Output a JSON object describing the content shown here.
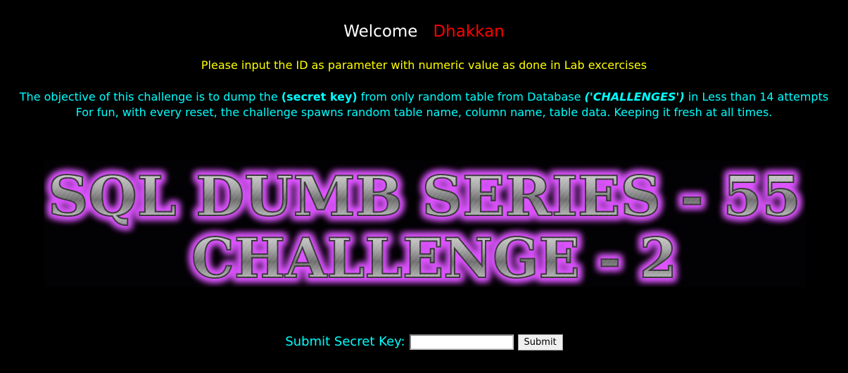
{
  "header": {
    "welcome_text": "Welcome",
    "username": "Dhakkan"
  },
  "instruction": "Please input the ID as parameter with numeric value as done in Lab excercises",
  "objective": {
    "line1_part1": "The objective of this challenge is to dump the ",
    "secret_key": "(secret key)",
    "line1_part2": " from only random table from Database ",
    "database": "('CHALLENGES')",
    "line1_part3": " in Less than 14 attempts",
    "line2": "For fun, with every reset, the challenge spawns random table name, column name, table data. Keeping it fresh at all times."
  },
  "banner": {
    "line1": "SQL DUMB SERIES - 55",
    "line2": "CHALLENGE - 2"
  },
  "form": {
    "label": "Submit Secret Key:",
    "input_value": "",
    "button_label": "Submit"
  },
  "colors": {
    "background": "#000000",
    "welcome": "#ffffff",
    "username": "#ff0000",
    "instruction": "#ffff00",
    "objective": "#00ffff",
    "banner_glow": "#cc33ff",
    "banner_metal": "#9a9a9a"
  }
}
